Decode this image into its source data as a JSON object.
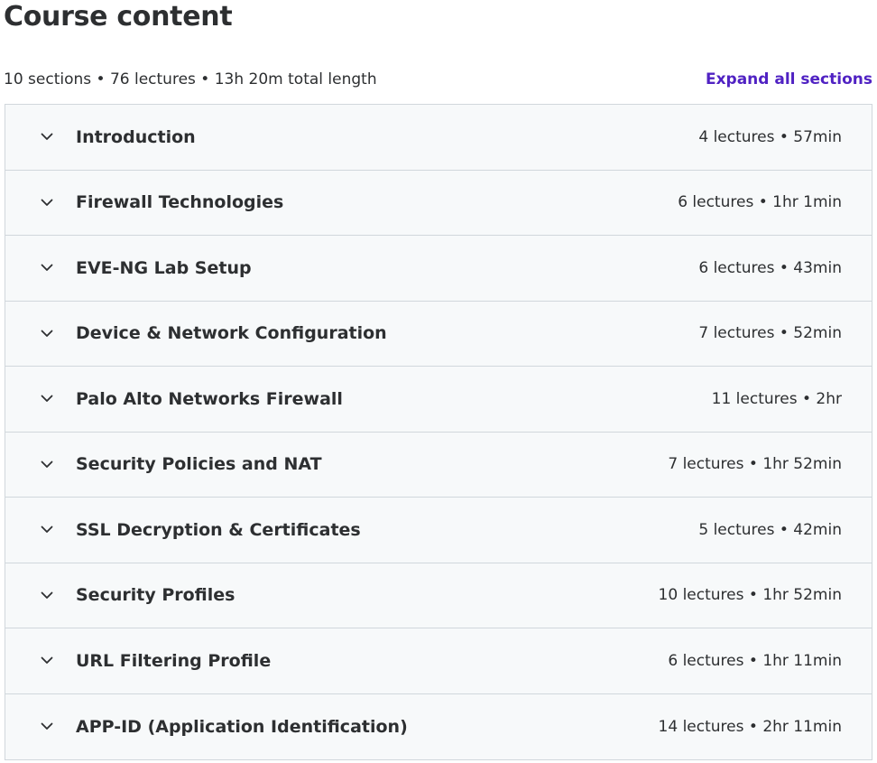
{
  "page": {
    "title": "Course content"
  },
  "summary": {
    "text": "10 sections • 76 lectures • 13h 20m total length",
    "expand_label": "Expand all sections"
  },
  "colors": {
    "accent": "#5022c3",
    "text": "#2d2f31",
    "row_bg": "#f7f9fa",
    "border": "#d1d7dc"
  },
  "sections": [
    {
      "title": "Introduction",
      "meta": "4 lectures • 57min",
      "icon": "chevron-down-icon"
    },
    {
      "title": "Firewall Technologies",
      "meta": "6 lectures • 1hr 1min",
      "icon": "chevron-down-icon"
    },
    {
      "title": "EVE-NG Lab Setup",
      "meta": "6 lectures • 43min",
      "icon": "chevron-down-icon"
    },
    {
      "title": "Device & Network Configuration",
      "meta": "7 lectures • 52min",
      "icon": "chevron-down-icon"
    },
    {
      "title": "Palo Alto Networks Firewall",
      "meta": "11 lectures • 2hr",
      "icon": "chevron-down-icon"
    },
    {
      "title": "Security Policies and NAT",
      "meta": "7 lectures • 1hr 52min",
      "icon": "chevron-down-icon"
    },
    {
      "title": "SSL Decryption & Certificates",
      "meta": "5 lectures • 42min",
      "icon": "chevron-down-icon"
    },
    {
      "title": "Security Profiles",
      "meta": "10 lectures • 1hr 52min",
      "icon": "chevron-down-icon"
    },
    {
      "title": "URL Filtering Profile",
      "meta": "6 lectures • 1hr 11min",
      "icon": "chevron-down-icon"
    },
    {
      "title": "APP-ID (Application Identification)",
      "meta": "14 lectures • 2hr 11min",
      "icon": "chevron-down-icon"
    }
  ]
}
